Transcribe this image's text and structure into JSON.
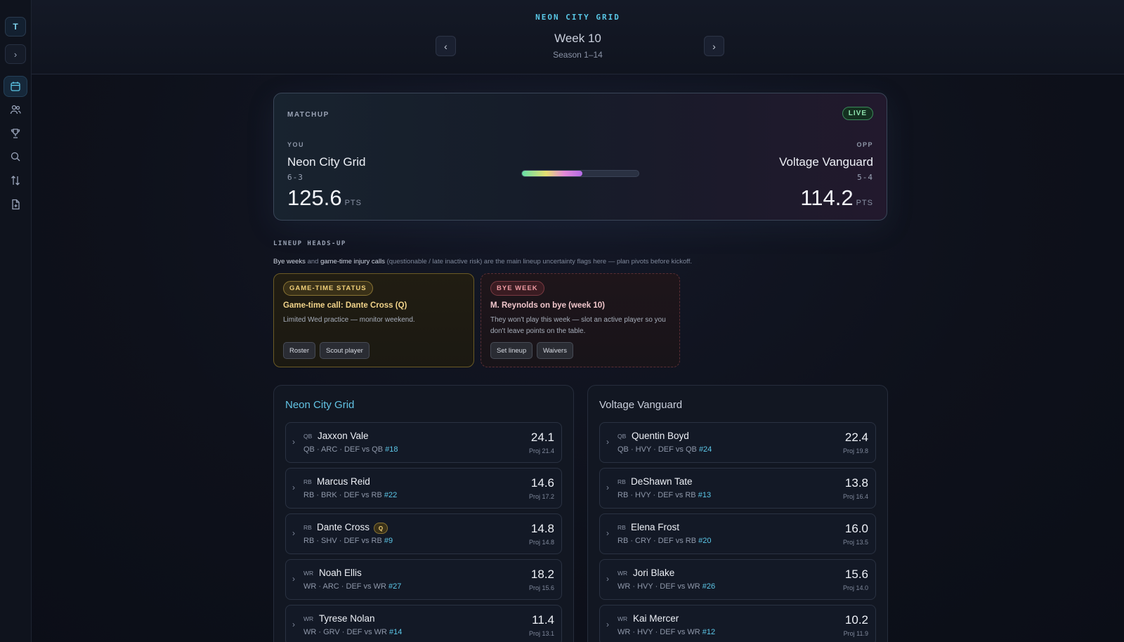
{
  "sidebar": {
    "avatar": "T",
    "expand_icon": "›",
    "icons": [
      "calendar-icon",
      "users-icon",
      "trophy-icon",
      "search-icon",
      "transfer-icon",
      "document-add-icon"
    ]
  },
  "header": {
    "brand": "NEON CITY GRID",
    "week_title": "Week 10",
    "week_sub": "Season 1–14",
    "prev": "‹",
    "next": "›"
  },
  "matchup": {
    "label": "MATCHUP",
    "status": "LIVE",
    "you": {
      "tag": "YOU",
      "name": "Neon City Grid",
      "record": "6-3",
      "score": "125.6",
      "pts_label": "PTS"
    },
    "opp": {
      "tag": "OPP",
      "name": "Voltage Vanguard",
      "record": "5-4",
      "score": "114.2",
      "pts_label": "PTS"
    },
    "progress_fraction": 0.52
  },
  "headsup": {
    "title": "LINEUP HEADS-UP",
    "desc_bye": "Bye weeks",
    "desc_and": " and ",
    "desc_gt": "game-time injury calls",
    "desc_rest": " (questionable / late inactive risk) are the main lineup uncertainty flags here — plan pivots before kickoff.",
    "gametime": {
      "badge": "GAME-TIME STATUS",
      "headline": "Game-time call: Dante Cross (Q)",
      "body": "Limited Wed practice — monitor weekend.",
      "buttons": [
        "Roster",
        "Scout player"
      ]
    },
    "bye": {
      "badge": "BYE WEEK",
      "headline": "M. Reynolds on bye (week 10)",
      "body": "They won't play this week — slot an active player so you don't leave points on the table.",
      "buttons": [
        "Set lineup",
        "Waivers"
      ]
    }
  },
  "rosters": {
    "left": {
      "title": "Neon City Grid",
      "players": [
        {
          "pos": "QB",
          "name": "Jaxxon Vale",
          "meta": "QB · ARC · DEF vs QB ",
          "rank": "#18",
          "pts": "24.1",
          "proj": "Proj 21.4",
          "badge": ""
        },
        {
          "pos": "RB",
          "name": "Marcus Reid",
          "meta": "RB · BRK · DEF vs RB ",
          "rank": "#22",
          "pts": "14.6",
          "proj": "Proj 17.2",
          "badge": ""
        },
        {
          "pos": "RB",
          "name": "Dante Cross",
          "meta": "RB · SHV · DEF vs RB ",
          "rank": "#9",
          "pts": "14.8",
          "proj": "Proj 14.8",
          "badge": "Q"
        },
        {
          "pos": "WR",
          "name": "Noah Ellis",
          "meta": "WR · ARC · DEF vs WR ",
          "rank": "#27",
          "pts": "18.2",
          "proj": "Proj 15.6",
          "badge": ""
        },
        {
          "pos": "WR",
          "name": "Tyrese Nolan",
          "meta": "WR · GRV · DEF vs WR ",
          "rank": "#14",
          "pts": "11.4",
          "proj": "Proj 13.1",
          "badge": ""
        }
      ]
    },
    "right": {
      "title": "Voltage Vanguard",
      "players": [
        {
          "pos": "QB",
          "name": "Quentin Boyd",
          "meta": "QB · HVY · DEF vs QB ",
          "rank": "#24",
          "pts": "22.4",
          "proj": "Proj 19.8",
          "badge": ""
        },
        {
          "pos": "RB",
          "name": "DeShawn Tate",
          "meta": "RB · HVY · DEF vs RB ",
          "rank": "#13",
          "pts": "13.8",
          "proj": "Proj 16.4",
          "badge": ""
        },
        {
          "pos": "RB",
          "name": "Elena Frost",
          "meta": "RB · CRY · DEF vs RB ",
          "rank": "#20",
          "pts": "16.0",
          "proj": "Proj 13.5",
          "badge": ""
        },
        {
          "pos": "WR",
          "name": "Jori Blake",
          "meta": "WR · HVY · DEF vs WR ",
          "rank": "#26",
          "pts": "15.6",
          "proj": "Proj 14.0",
          "badge": ""
        },
        {
          "pos": "WR",
          "name": "Kai Mercer",
          "meta": "WR · HVY · DEF vs WR ",
          "rank": "#12",
          "pts": "10.2",
          "proj": "Proj 11.9",
          "badge": ""
        }
      ]
    }
  }
}
